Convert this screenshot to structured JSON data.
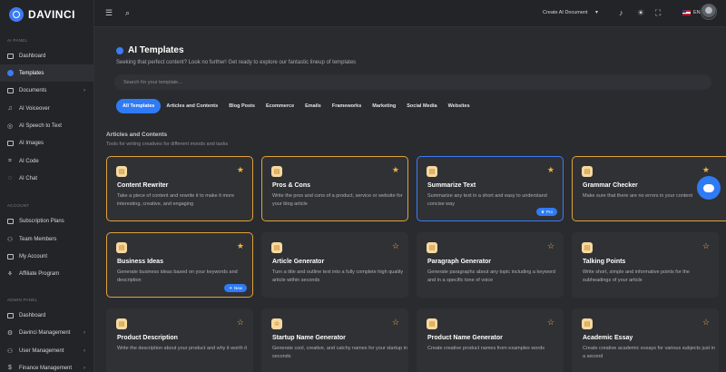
{
  "app": {
    "name": "DAVINCI"
  },
  "topbar": {
    "create_document": "Create AI Document",
    "language": "EN"
  },
  "sidebar": {
    "sections": [
      {
        "label": "AI PANEL",
        "items": [
          {
            "label": "Dashboard",
            "icon": "dashboard-icon"
          },
          {
            "label": "Templates",
            "icon": "templates-icon",
            "active": true
          },
          {
            "label": "Documents",
            "icon": "folder-icon",
            "chevron": true
          },
          {
            "label": "AI Voiceover",
            "icon": "voiceover-icon"
          },
          {
            "label": "AI Speech to Text",
            "icon": "speech-icon"
          },
          {
            "label": "AI Images",
            "icon": "images-icon"
          },
          {
            "label": "AI Code",
            "icon": "code-icon"
          },
          {
            "label": "AI Chat",
            "icon": "chat-icon"
          }
        ]
      },
      {
        "label": "ACCOUNT",
        "items": [
          {
            "label": "Subscription Plans",
            "icon": "plans-icon"
          },
          {
            "label": "Team Members",
            "icon": "team-icon"
          },
          {
            "label": "My Account",
            "icon": "account-icon"
          },
          {
            "label": "Affiliate Program",
            "icon": "affiliate-icon"
          }
        ]
      },
      {
        "label": "ADMIN PANEL",
        "items": [
          {
            "label": "Dashboard",
            "icon": "dashboard-icon"
          },
          {
            "label": "Davinci Management",
            "icon": "management-icon",
            "chevron": true
          },
          {
            "label": "User Management",
            "icon": "users-icon",
            "chevron": true
          },
          {
            "label": "Finance Management",
            "icon": "finance-icon",
            "chevron": true
          }
        ]
      }
    ]
  },
  "page": {
    "title": "AI Templates",
    "subtitle": "Seeking that perfect content? Look no further! Get ready to explore our fantastic lineup of templates",
    "search_placeholder": "Search for your template...",
    "tabs": [
      "All Templates",
      "Articles and Contents",
      "Blog Posts",
      "Ecommerce",
      "Emails",
      "Frameworks",
      "Marketing",
      "Social Media",
      "Websites"
    ],
    "section_heading": "Articles and Contents",
    "section_desc": "Tools for writing creatives for different moods and tasks"
  },
  "cards": [
    {
      "title": "Content Rewriter",
      "desc": "Take a piece of content and rewrite it to make it more interesting, creative, and engaging",
      "border": "orange",
      "fav": "filled"
    },
    {
      "title": "Pros & Cons",
      "desc": "Write the pros and cons of a product, service or website for your blog article",
      "border": "orange",
      "fav": "filled"
    },
    {
      "title": "Summarize Text",
      "desc": "Summarize any text in a short and easy to understand concise way",
      "border": "blue",
      "fav": "filled",
      "badge": "Pro"
    },
    {
      "title": "Grammar Checker",
      "desc": "Make sure that there are no errors in your content",
      "border": "orange",
      "fav": "filled"
    },
    {
      "title": "Business Ideas",
      "desc": "Generate business ideas based on your keywords and description",
      "border": "orange",
      "fav": "filled",
      "badge": "New"
    },
    {
      "title": "Article Generator",
      "desc": "Turn a title and outline text into a fully complete high quality article within seconds",
      "border": "none",
      "fav": "outline"
    },
    {
      "title": "Paragraph Generator",
      "desc": "Generate paragraphs about any topic including a keyword and in a specific tone of voice",
      "border": "none",
      "fav": "outline"
    },
    {
      "title": "Talking Points",
      "desc": "Write short, simple and informative points for the subheadings of your article",
      "border": "none",
      "fav": "outline"
    },
    {
      "title": "Product Description",
      "desc": "Write the description about your product and why it worth it",
      "border": "none",
      "fav": "outline"
    },
    {
      "title": "Startup Name Generator",
      "desc": "Generate cool, creative, and catchy names for your startup in seconds",
      "border": "none",
      "fav": "outline"
    },
    {
      "title": "Product Name Generator",
      "desc": "Create creative product names from examples words",
      "border": "none",
      "fav": "outline"
    },
    {
      "title": "Academic Essay",
      "desc": "Create creative academic essays for various subjects just in a second",
      "border": "none",
      "fav": "outline"
    }
  ],
  "colors": {
    "accent": "#2f7bf5",
    "highlight": "#e0a23a",
    "background": "#2a2b2f",
    "sidebar": "#232428"
  }
}
